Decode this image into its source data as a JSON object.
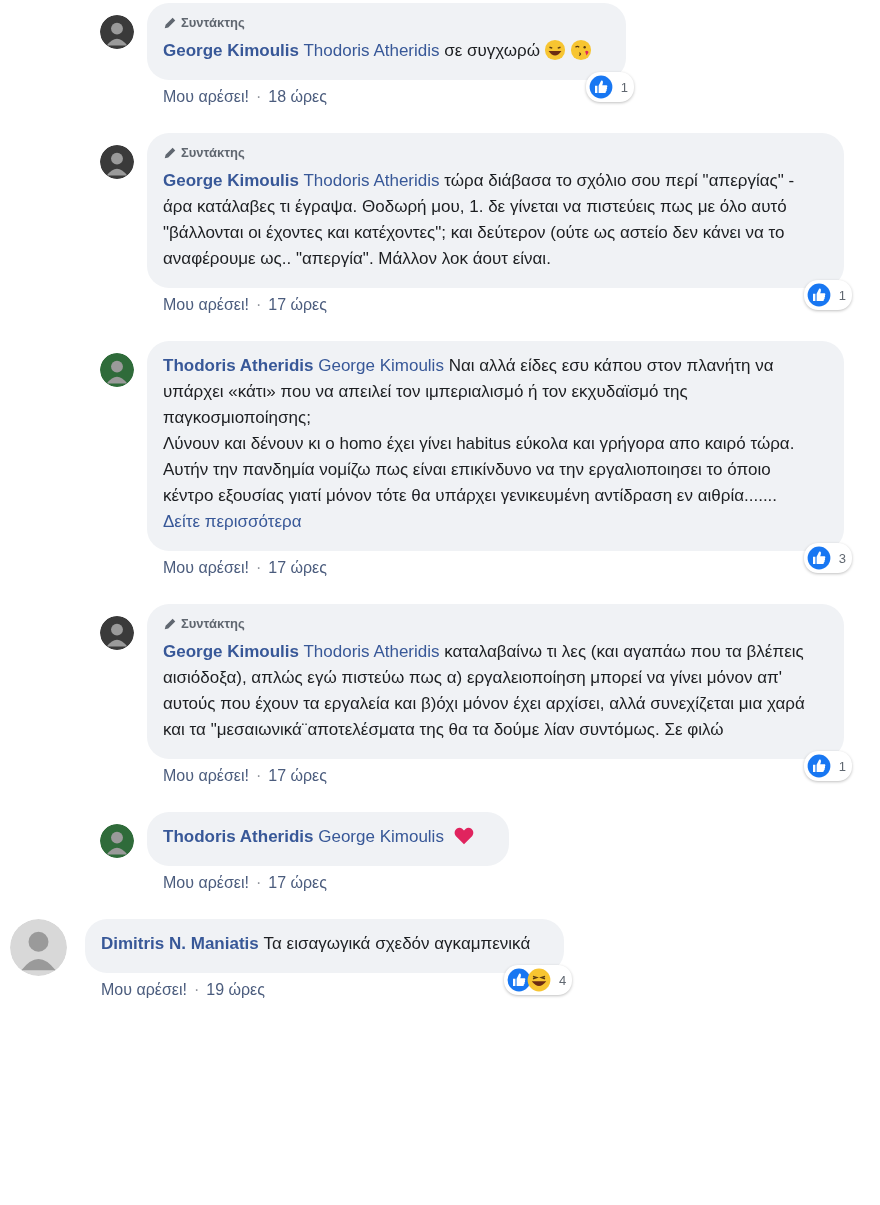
{
  "comments": [
    {
      "kind": "reply",
      "avatar": {
        "color": "#3a3a3a"
      },
      "badge": "Συντάκτης",
      "author": "George Kimoulis",
      "mention": "Thodoris Atheridis",
      "text": "σε συγχωρώ",
      "emojis": [
        {
          "kind": "laugh"
        },
        {
          "kind": "kiss"
        }
      ],
      "like_link": "Μου αρέσει!",
      "separator": "·",
      "time": "18 ώρες",
      "reactions": [
        {
          "kind": "like"
        }
      ],
      "reaction_count": "1"
    },
    {
      "kind": "reply",
      "avatar": {
        "color": "#3a3a3a"
      },
      "badge": "Συντάκτης",
      "author": "George Kimoulis",
      "mention": "Thodoris Atheridis",
      "text": "τώρα διάβασα το σχόλιο σου περί \"απεργίας\" - άρα κατάλαβες τι έγραψα. Θοδωρή μου, 1. δε γίνεται να πιστεύεις πως με όλο αυτό \"βάλλονται οι έχοντες και κατέχοντες\"; και δεύτερον (ούτε ως αστείο δεν κάνει να το αναφέρουμε ως.. \"απεργία\". Μάλλον λοκ άουτ είναι.",
      "like_link": "Μου αρέσει!",
      "separator": "·",
      "time": "17 ώρες",
      "reactions": [
        {
          "kind": "like"
        }
      ],
      "reaction_count": "1"
    },
    {
      "kind": "reply",
      "avatar": {
        "color": "#2f6b3a"
      },
      "author": "Thodoris Atheridis",
      "mention": "George Kimoulis",
      "text": "Ναι αλλά είδες εσυ κάπου στον πλανήτη να υπάρχει «κάτι» που να απειλεί τον ιμπεριαλισμό ή τον εκχυδαϊσμό της παγκοσμιοποίησης;\nΛύνουν και δένουν κι ο homo έχει γίνει habitus εύκολα και γρήγορα απο καιρό τώρα.\nΑυτήν την πανδημία νομίζω πως είναι επικίνδυνο να την εργαλιοποιησει το όποιο κέντρο εξουσίας γιατί μόνον τότε θα υπάρχει γενικευμένη αντίδραση εν αιθρία.......",
      "see_more": "Δείτε περισσότερα",
      "like_link": "Μου αρέσει!",
      "separator": "·",
      "time": "17 ώρες",
      "reactions": [
        {
          "kind": "like"
        }
      ],
      "reaction_count": "3"
    },
    {
      "kind": "reply",
      "avatar": {
        "color": "#3a3a3a"
      },
      "badge": "Συντάκτης",
      "author": "George Kimoulis",
      "mention": "Thodoris Atheridis",
      "text": "καταλαβαίνω τι λες (και αγαπάω που τα βλέπεις αισιόδοξα), απλώς εγώ πιστεύω πως α) εργαλειοποίηση μπορεί να γίνει μόνον απ' αυτούς που έχουν τα εργαλεία και β)όχι μόνον έχει αρχίσει, αλλά συνεχίζεται μια χαρά και τα \"μεσαιωνικά¨αποτελέσματα της θα τα δούμε λίαν συντόμως. Σε φιλώ",
      "like_link": "Μου αρέσει!",
      "separator": "·",
      "time": "17 ώρες",
      "reactions": [
        {
          "kind": "like"
        }
      ],
      "reaction_count": "1"
    },
    {
      "kind": "reply",
      "avatar": {
        "color": "#2f6b3a"
      },
      "author": "Thodoris Atheridis",
      "mention": "George Kimoulis",
      "emojis": [
        {
          "kind": "heart"
        }
      ],
      "like_link": "Μου αρέσει!",
      "separator": "·",
      "time": "17 ώρες"
    },
    {
      "kind": "top",
      "avatar": {
        "color": "#d8d8d8"
      },
      "author": "Dimitris N. Maniatis",
      "text": "Τα εισαγωγικά σχεδόν αγκαμπενικά",
      "like_link": "Μου αρέσει!",
      "separator": "·",
      "time": "19 ώρες",
      "reactions": [
        {
          "kind": "like"
        },
        {
          "kind": "haha"
        }
      ],
      "reaction_count": "4"
    }
  ]
}
